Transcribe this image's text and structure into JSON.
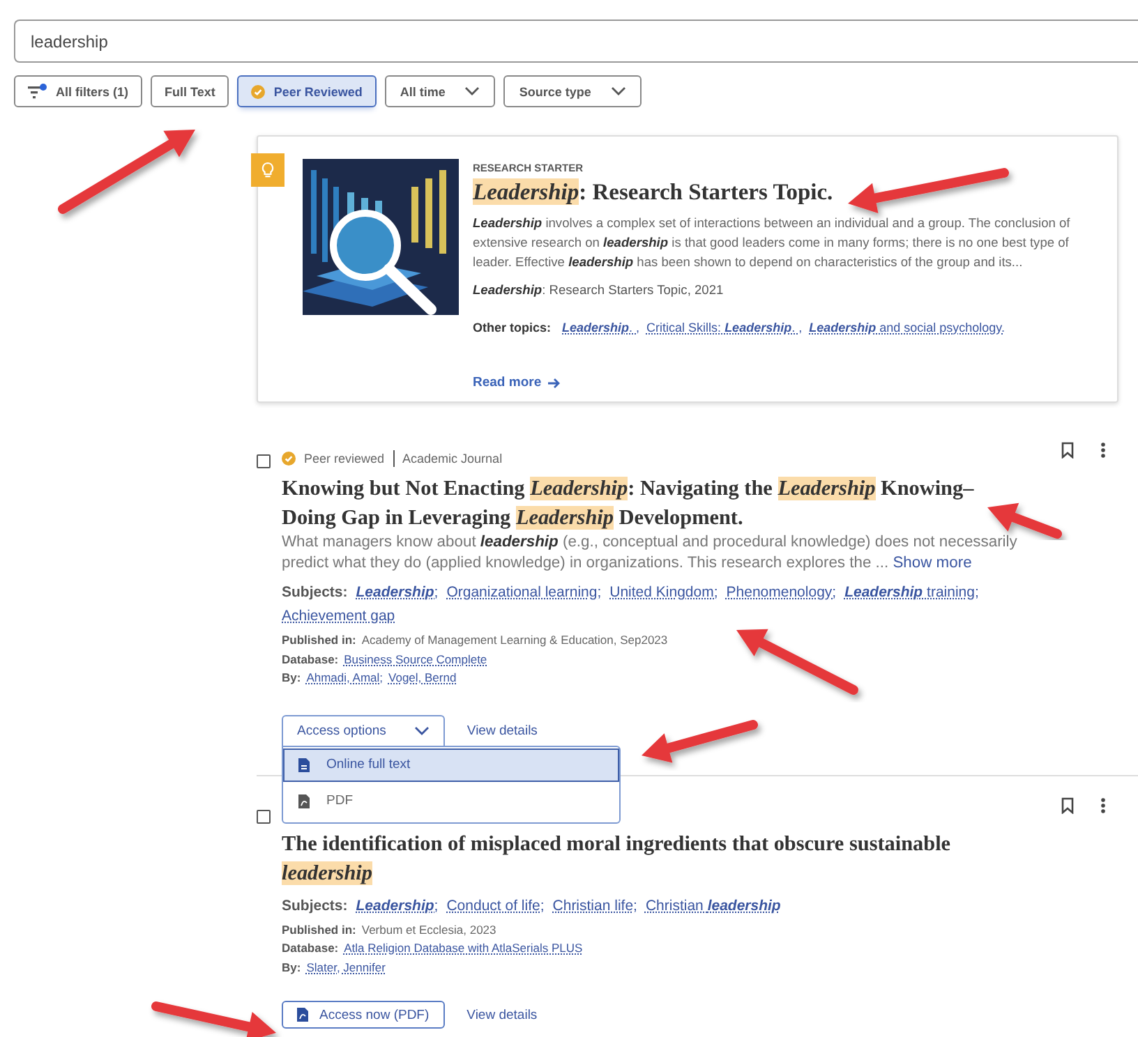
{
  "search": {
    "value": "leadership"
  },
  "filters": [
    {
      "kind": "filters",
      "label": "All filters (1)",
      "selected": false
    },
    {
      "kind": "toggle",
      "label": "Full Text",
      "selected": false
    },
    {
      "kind": "toggle",
      "label": "Peer Reviewed",
      "selected": true
    },
    {
      "kind": "dropdown",
      "label": "All time",
      "selected": false
    },
    {
      "kind": "dropdown",
      "label": "Source type",
      "selected": false
    }
  ],
  "research_starter": {
    "eyebrow": "RESEARCH STARTER",
    "title": "*Leadership*: Research Starters Topic.",
    "description": "*Leadership* involves a complex set of interactions between an individual and a group. The conclusion of extensive research on *leadership* is that good leaders come in many forms; there is no one best type of leader. Effective *leadership* has been shown to depend on characteristics of the group and its...",
    "citation": "*Leadership*: Research Starters Topic, 2021",
    "other_topics_label": "Other topics:",
    "other_topics": [
      "*Leadership*. ,",
      "Critical Skills: *Leadership*. ,",
      "*Leadership* and social psychology."
    ],
    "read_more": "Read more"
  },
  "results": [
    {
      "checked": false,
      "review_label": "Peer reviewed",
      "source_type": "Academic Journal",
      "title": "Knowing but Not Enacting *Leadership*: Navigating the *Leadership* Knowing–Doing Gap in Leveraging *Leadership* Development.",
      "abstract": "What managers know about *leadership* (e.g., conceptual and procedural knowledge) does not necessarily predict what they do (applied knowledge) in organizations. This research explores the ...",
      "show_more": "Show more",
      "subjects_label": "Subjects:",
      "subjects": [
        "*Leadership*;",
        "Organizational learning;",
        "United Kingdom;",
        "Phenomenology;",
        "*Leadership* training;",
        "Achievement gap"
      ],
      "published_label": "Published in:",
      "published": "Academy of Management Learning & Education, Sep2023",
      "database_label": "Database:",
      "database": "Business Source Complete",
      "by_label": "By:",
      "authors": [
        "Ahmadi, Amal;",
        "Vogel, Bernd"
      ],
      "access": {
        "kind": "menu",
        "label": "Access options",
        "expanded": true,
        "options": [
          {
            "label": "Online full text",
            "selected": true
          },
          {
            "label": "PDF",
            "selected": false
          }
        ]
      },
      "view_details": "View details"
    },
    {
      "checked": false,
      "title": "The identification of misplaced moral ingredients that obscure sustainable *leadership*",
      "subjects_label": "Subjects:",
      "subjects": [
        "*Leadership*;",
        "Conduct of life;",
        "Christian life;",
        "Christian *leadership*"
      ],
      "published_label": "Published in:",
      "published": "Verbum et Ecclesia, 2023",
      "database_label": "Database:",
      "database": "Atla Religion Database with AtlaSerials PLUS",
      "by_label": "By:",
      "authors": [
        "Slater, Jennifer"
      ],
      "access": {
        "kind": "button",
        "label": "Access now (PDF)"
      },
      "view_details": "View details"
    }
  ],
  "annotations": [
    {
      "kind": "arrow"
    },
    {
      "kind": "arrow"
    },
    {
      "kind": "arrow"
    },
    {
      "kind": "arrow"
    },
    {
      "kind": "arrow"
    },
    {
      "kind": "arrow"
    }
  ]
}
